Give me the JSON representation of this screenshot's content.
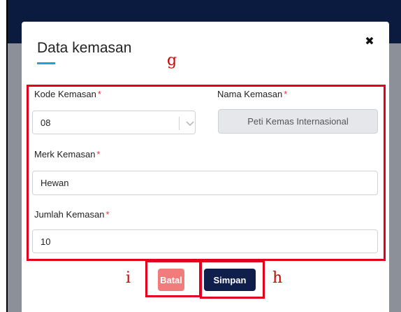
{
  "modal": {
    "title": "Data kemasan",
    "close_symbol": "✖"
  },
  "annotations": {
    "g": "g",
    "h": "h",
    "i": "i"
  },
  "form": {
    "kode": {
      "label": "Kode Kemasan",
      "required": "*",
      "value": "08"
    },
    "nama": {
      "label": "Nama Kemasan",
      "required": "*",
      "value": "Peti Kemas Internasional"
    },
    "merk": {
      "label": "Merk Kemasan",
      "required": "*",
      "value": "Hewan"
    },
    "jumlah": {
      "label": "Jumlah Kemasan",
      "required": "*",
      "value": "10"
    }
  },
  "buttons": {
    "batal": "Batal",
    "simpan": "Simpan"
  },
  "colors": {
    "accent": "#1fa3d6",
    "primary": "#0f1e4a",
    "danger": "#f07c7c",
    "annotation": "#e3001b"
  },
  "icons": {
    "close": "close-icon",
    "select": "chevron-down-icon"
  }
}
